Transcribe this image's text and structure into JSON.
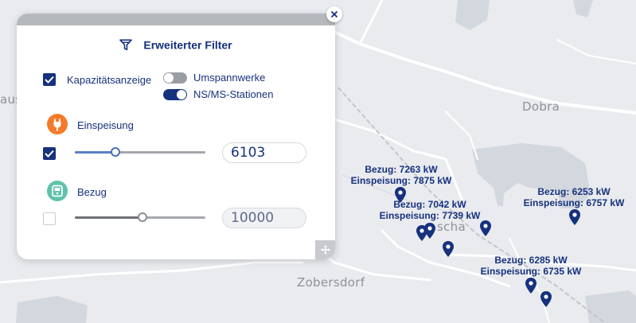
{
  "map": {
    "place_labels": {
      "dobra": "Dobra",
      "zobersdorf": "Zobersdorf",
      "aus": "aus",
      "scha": "scha"
    },
    "callouts": [
      {
        "bezug": "Bezug: 7263 kW",
        "einspeisung": "Einspeisung: 7875 kW"
      },
      {
        "bezug": "Bezug: 7042 kW",
        "einspeisung": "Einspeisung: 7739 kW"
      },
      {
        "bezug": "Bezug: 6253 kW",
        "einspeisung": "Einspeisung: 6757 kW"
      },
      {
        "bezug": "Bezug: 6285 kW",
        "einspeisung": "Einspeisung: 6735 kW"
      }
    ],
    "marker_icon": "map-pin-icon",
    "marker_color": "#16317d"
  },
  "filter": {
    "title": "Erweiterter Filter",
    "title_icon": "filter-icon",
    "close_icon": "close-icon",
    "kapazitaet": {
      "label": "Kapazitätsanzeige",
      "checked": true
    },
    "toggles": [
      {
        "label": "Umspannwerke",
        "on": false
      },
      {
        "label": "NS/MS-Stationen",
        "on": true
      }
    ],
    "einspeisung": {
      "label": "Einspeisung",
      "icon": "plug-icon",
      "icon_color": "#f47b2a",
      "checked": true,
      "value": "6103",
      "slider_level": 0.31
    },
    "bezug": {
      "label": "Bezug",
      "icon": "meter-icon",
      "icon_color": "#5ec3a8",
      "checked": false,
      "value": "10000",
      "slider_level": 0.52
    },
    "move_icon": "move-icon"
  },
  "colors": {
    "accent": "#16317d",
    "map_background": "#e9ebef"
  }
}
